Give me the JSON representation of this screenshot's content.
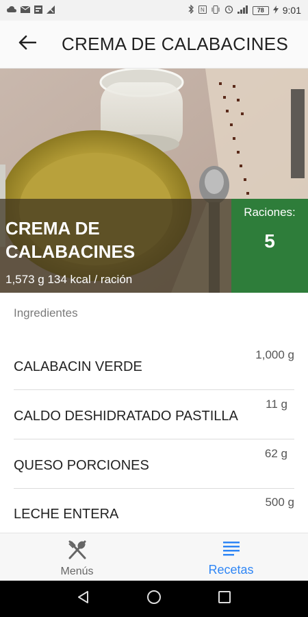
{
  "status_bar": {
    "time": "9:01",
    "battery": "78",
    "icons_left": [
      "cloud-icon",
      "mail-icon",
      "gallery-icon",
      "no-signal-icon"
    ],
    "icons_right": [
      "bluetooth-icon",
      "nfc-icon",
      "vibrate-icon",
      "alarm-icon",
      "signal-icon",
      "battery-icon",
      "charging-icon"
    ]
  },
  "app_bar": {
    "title": "CREMA DE CALABACINES",
    "back_icon": "arrow-back-icon"
  },
  "hero": {
    "title": "CREMA DE CALABACINES",
    "subtitle": "1,573 g 134 kcal / ración",
    "raciones_label": "Raciones:",
    "raciones_value": "5",
    "accent_color": "#2e7d3a"
  },
  "ingredients": {
    "header": "Ingredientes",
    "items": [
      {
        "name": "CALABACIN VERDE",
        "qty": "1,000 g"
      },
      {
        "name": "CALDO DESHIDRATADO PASTILLA",
        "qty": "11 g"
      },
      {
        "name": "QUESO PORCIONES",
        "qty": "62 g"
      },
      {
        "name": "LECHE ENTERA",
        "qty": "500 g"
      }
    ]
  },
  "bottom_nav": {
    "items": [
      {
        "label": "Menús",
        "icon": "fork-knife-icon",
        "active": false
      },
      {
        "label": "Recetas",
        "icon": "list-icon",
        "active": true
      }
    ],
    "active_color": "#2f86f5"
  },
  "system_nav": {
    "buttons": [
      "back-triangle-icon",
      "home-circle-icon",
      "recents-square-icon"
    ]
  }
}
